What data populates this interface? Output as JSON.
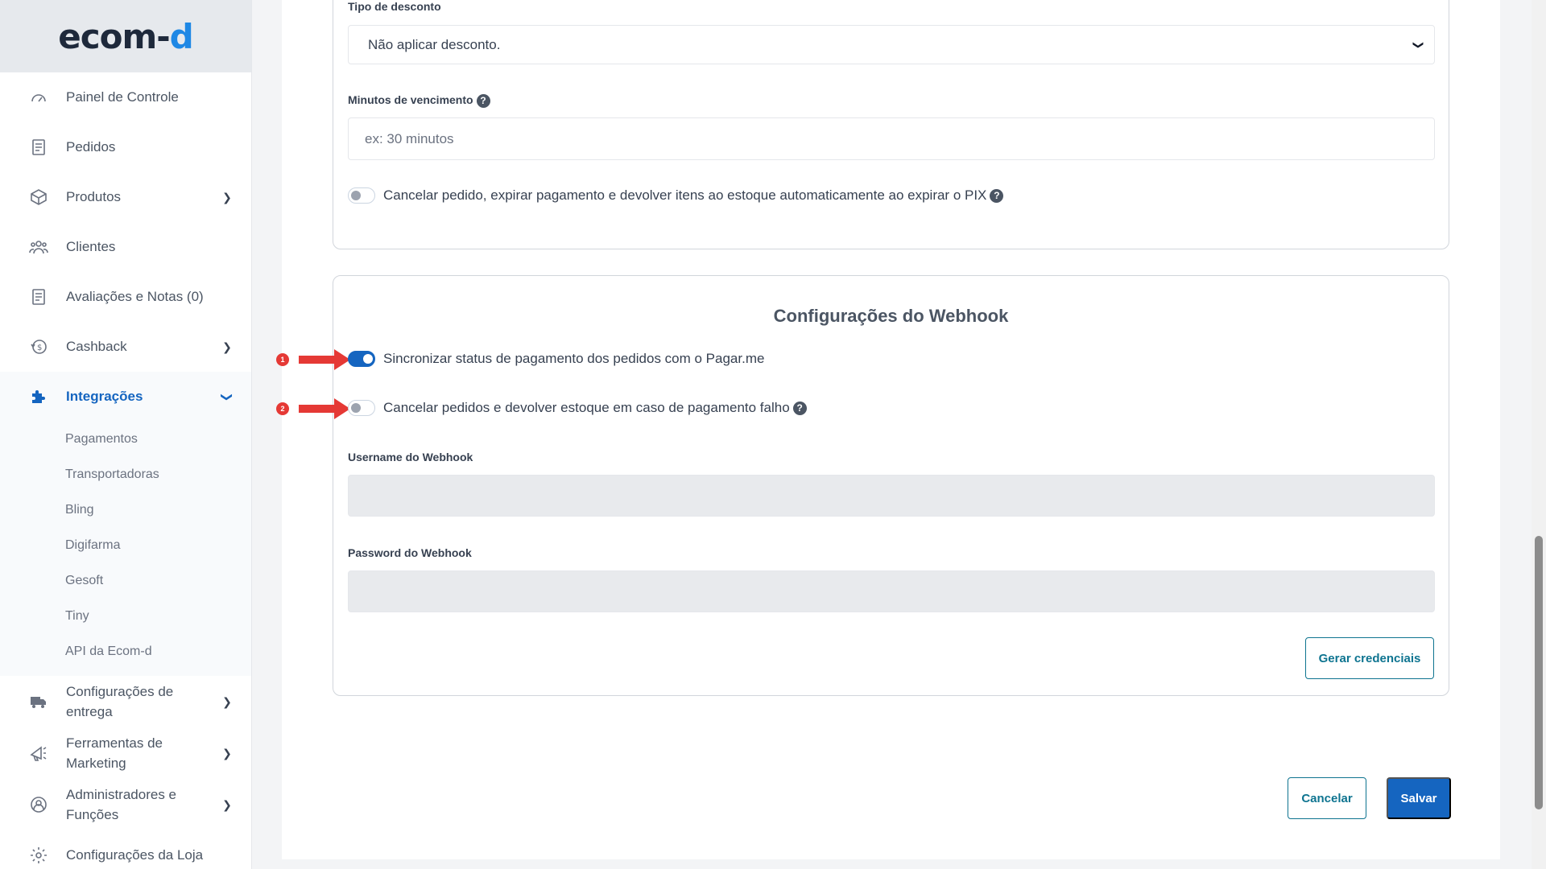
{
  "logo": {
    "text_main": "ecom-",
    "text_accent": "d"
  },
  "sidebar": {
    "items": [
      {
        "label": "Painel de Controle"
      },
      {
        "label": "Pedidos"
      },
      {
        "label": "Produtos"
      },
      {
        "label": "Clientes"
      },
      {
        "label": "Avaliações e Notas (0)"
      },
      {
        "label": "Cashback"
      },
      {
        "label": "Integrações"
      },
      {
        "label": "Configurações de entrega"
      },
      {
        "label": "Ferramentas de Marketing"
      },
      {
        "label": "Administradores e Funções"
      },
      {
        "label": "Configurações da Loja"
      }
    ],
    "subitems": [
      {
        "label": "Pagamentos"
      },
      {
        "label": "Transportadoras"
      },
      {
        "label": "Bling"
      },
      {
        "label": "Digifarma"
      },
      {
        "label": "Gesoft"
      },
      {
        "label": "Tiny"
      },
      {
        "label": "API da Ecom-d"
      }
    ]
  },
  "pix": {
    "discount_label": "Tipo de desconto",
    "discount_value": "Não aplicar desconto.",
    "expiry_label": "Minutos de vencimento",
    "expiry_placeholder": "ex: 30 minutos",
    "cancel_toggle_label": "Cancelar pedido, expirar pagamento e devolver itens ao estoque automaticamente ao expirar o PIX",
    "cancel_toggle_on": false
  },
  "webhook": {
    "title": "Configurações do Webhook",
    "sync_label": "Sincronizar status de pagamento dos pedidos com o Pagar.me",
    "sync_on": true,
    "cancel_label": "Cancelar pedidos e devolver estoque em caso de pagamento falho",
    "cancel_on": false,
    "username_label": "Username do Webhook",
    "username_value": "",
    "password_label": "Password do Webhook",
    "password_value": "",
    "generate_label": "Gerar credenciais"
  },
  "annotations": {
    "first": "1",
    "second": "2"
  },
  "footer": {
    "cancel_label": "Cancelar",
    "save_label": "Salvar"
  },
  "colors": {
    "primary": "#1565c0",
    "arrow": "#e53935"
  }
}
